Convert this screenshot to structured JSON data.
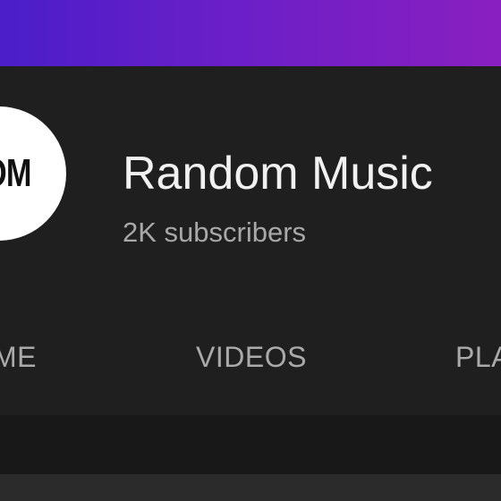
{
  "channel": {
    "avatar_text": "OM",
    "name": "Random Music",
    "subscribers": "2K subscribers"
  },
  "tabs": [
    {
      "label": "ME"
    },
    {
      "label": "VIDEOS"
    },
    {
      "label": "PLA"
    }
  ],
  "colors": {
    "banner_start": "#4a1ec9",
    "banner_end": "#8a1fc0",
    "background": "#1f1f1f",
    "text_primary": "#f1f1f1",
    "text_secondary": "#aaaaaa"
  }
}
